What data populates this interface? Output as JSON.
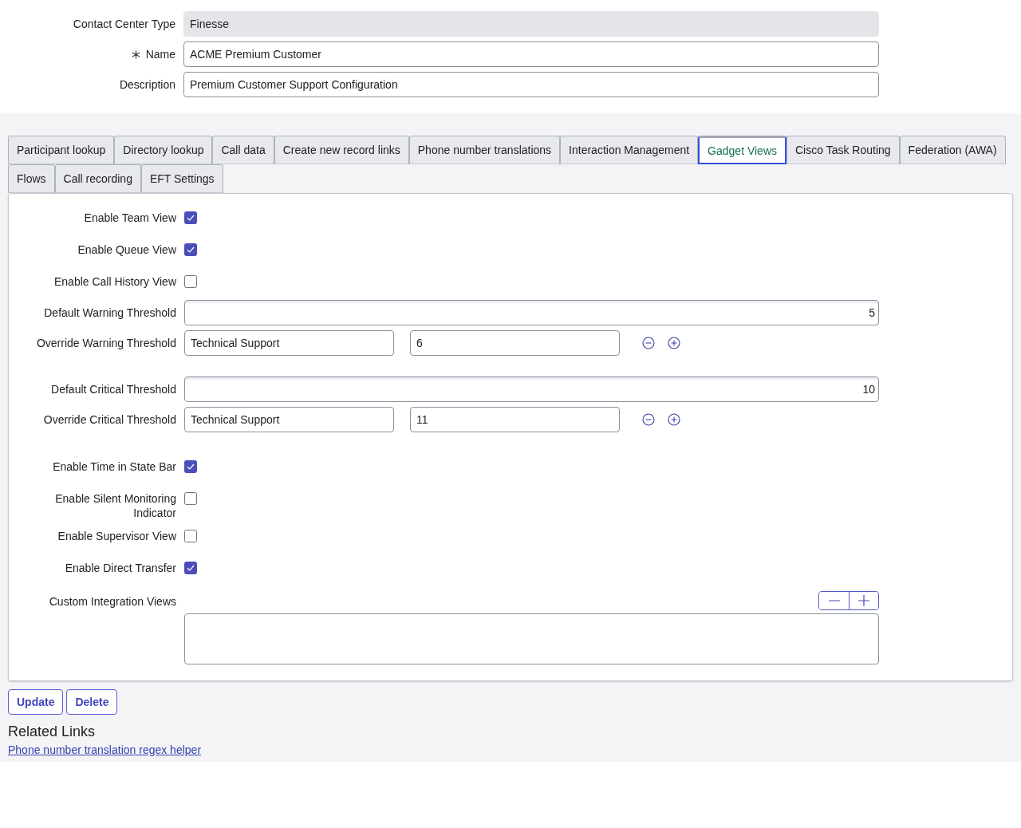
{
  "header_fields": [
    {
      "label": "Contact Center Type",
      "value": "Finesse",
      "required": false,
      "disabled": true
    },
    {
      "label": "Name",
      "value": "ACME Premium Customer",
      "required": true,
      "disabled": false
    },
    {
      "label": "Description",
      "value": "Premium Customer Support Configuration",
      "required": false,
      "disabled": false
    }
  ],
  "tabs": [
    {
      "label": "Participant lookup",
      "selected": false
    },
    {
      "label": "Directory lookup",
      "selected": false
    },
    {
      "label": "Call data",
      "selected": false
    },
    {
      "label": "Create new record links",
      "selected": false
    },
    {
      "label": "Phone number translations",
      "selected": false
    },
    {
      "label": "Interaction Management",
      "selected": false
    },
    {
      "label": "Gadget Views",
      "selected": true
    },
    {
      "label": "Cisco Task Routing",
      "selected": false
    },
    {
      "label": "Federation (AWA)",
      "selected": false
    },
    {
      "label": "Flows",
      "selected": false
    },
    {
      "label": "Call recording",
      "selected": false
    },
    {
      "label": "EFT Settings",
      "selected": false
    }
  ],
  "settings": [
    {
      "kind": "checkbox",
      "label": "Enable Team View",
      "checked": true
    },
    {
      "kind": "checkbox",
      "label": "Enable Queue View",
      "checked": true
    },
    {
      "kind": "checkbox",
      "label": "Enable Call History View",
      "checked": false
    },
    {
      "kind": "number",
      "label": "Default Warning Threshold",
      "value": "5"
    },
    {
      "kind": "override",
      "label": "Override Warning Threshold",
      "queue": "Technical Support",
      "value": "6"
    },
    {
      "kind": "number",
      "label": "Default Critical Threshold",
      "value": "10"
    },
    {
      "kind": "override",
      "label": "Override Critical Threshold",
      "queue": "Technical Support",
      "value": "11"
    },
    {
      "kind": "checkbox",
      "label": "Enable Time in State Bar",
      "checked": true
    },
    {
      "kind": "checkbox",
      "label": "Enable Silent Monitoring Indicator",
      "checked": false
    },
    {
      "kind": "checkbox",
      "label": "Enable Supervisor View",
      "checked": false
    },
    {
      "kind": "checkbox",
      "label": "Enable Direct Transfer",
      "checked": true
    }
  ],
  "custom_integration_views": {
    "label": "Custom Integration Views"
  },
  "buttons": [
    {
      "label": "Update"
    },
    {
      "label": "Delete"
    }
  ],
  "related_links": {
    "title": "Related Links",
    "links": [
      "Phone number translation regex helper"
    ]
  }
}
